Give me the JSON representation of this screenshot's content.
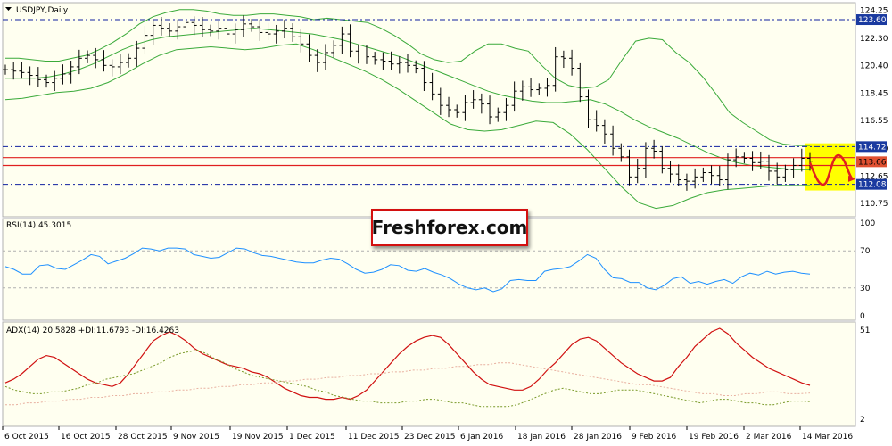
{
  "symbol_title": "USDJPY,Daily",
  "brand": "Freshforex.com",
  "colors": {
    "background": "#fffff0",
    "frame": "#b0b0b0",
    "candle": "#000000",
    "bollinger": "#3aaa3a",
    "level_line": "#1020a0",
    "red_line": "#e02020",
    "rsi_line": "#1e90ff",
    "adx_line": "#d01010",
    "di_plus": "#7a9a2a",
    "di_minus": "#e8b0a0",
    "highlight": "#ffff00",
    "price_label_blue": "#1a3aa0",
    "price_label_red": "#e05030"
  },
  "chart_data": [
    {
      "type": "candlestick",
      "title": "USDJPY,Daily",
      "x": [
        "6 Oct 2015",
        "16 Oct 2015",
        "28 Oct 2015",
        "9 Nov 2015",
        "19 Nov 2015",
        "1 Dec 2015",
        "11 Dec 2015",
        "23 Dec 2015",
        "6 Jan 2016",
        "18 Jan 2016",
        "28 Jan 2016",
        "9 Feb 2016",
        "19 Feb 2016",
        "2 Mar 2016",
        "14 Mar 2016"
      ],
      "y_ticks": [
        "124.25",
        "122.30",
        "120.40",
        "118.45",
        "116.55",
        "114.60",
        "112.65",
        "110.75"
      ],
      "ylim": [
        110.0,
        124.6
      ],
      "levels": [
        {
          "label": "123.60",
          "value": 123.6,
          "style": "dash-dot"
        },
        {
          "label": "114.72",
          "value": 114.72,
          "style": "dash-dot"
        },
        {
          "label": "112.08",
          "value": 112.08,
          "style": "dash-dot"
        }
      ],
      "current_price": {
        "label": "113.66",
        "value": 113.66
      },
      "red_band": [
        113.4,
        113.95
      ],
      "close": [
        120.1,
        120.0,
        119.9,
        119.7,
        119.4,
        119.2,
        119.5,
        119.8,
        120.3,
        120.9,
        121.1,
        120.8,
        120.4,
        120.3,
        120.6,
        120.9,
        121.6,
        122.5,
        123.2,
        123.0,
        122.8,
        123.1,
        123.4,
        123.2,
        122.9,
        122.8,
        123.0,
        122.6,
        122.9,
        123.3,
        123.1,
        122.7,
        122.6,
        122.8,
        123.0,
        122.4,
        121.9,
        121.1,
        120.6,
        121.3,
        121.8,
        122.6,
        121.4,
        121.2,
        121.0,
        120.8,
        120.7,
        120.5,
        120.6,
        120.4,
        120.2,
        119.2,
        118.4,
        117.6,
        117.3,
        117.1,
        117.8,
        118.0,
        117.7,
        116.8,
        117.1,
        117.6,
        118.6,
        118.9,
        118.7,
        118.8,
        119.0,
        121.0,
        120.9,
        120.2,
        118.2,
        116.6,
        116.2,
        115.6,
        114.6,
        114.0,
        112.6,
        113.2,
        114.6,
        114.4,
        113.2,
        112.8,
        112.4,
        112.3,
        112.6,
        112.9,
        112.7,
        112.4,
        113.8,
        114.0,
        113.9,
        113.6,
        113.7,
        113.0,
        112.6,
        113.1,
        113.4,
        113.9,
        113.7
      ],
      "bb_upper": [
        120.9,
        120.9,
        120.8,
        120.7,
        120.7,
        120.9,
        121.1,
        121.5,
        122.0,
        122.6,
        123.3,
        123.8,
        124.1,
        124.3,
        124.3,
        124.2,
        124.0,
        123.9,
        123.9,
        124.0,
        124.0,
        123.9,
        123.8,
        123.6,
        123.7,
        123.6,
        123.5,
        123.4,
        123.0,
        122.5,
        121.9,
        121.2,
        120.8,
        120.6,
        120.7,
        121.4,
        121.9,
        121.9,
        121.6,
        121.4,
        120.4,
        119.5,
        119.0,
        118.8,
        118.9,
        119.4,
        120.8,
        122.1,
        122.3,
        122.2,
        121.3,
        120.6,
        119.6,
        118.4,
        117.1,
        116.4,
        115.8,
        115.2,
        114.9,
        114.8,
        114.8
      ],
      "bb_middle": [
        119.5,
        119.5,
        119.5,
        119.6,
        119.8,
        120.1,
        120.5,
        121.0,
        121.5,
        121.9,
        122.2,
        122.4,
        122.5,
        122.6,
        122.7,
        122.8,
        122.9,
        123.0,
        122.9,
        122.8,
        122.7,
        122.6,
        122.4,
        122.2,
        121.9,
        121.6,
        121.3,
        121.0,
        120.6,
        120.2,
        119.8,
        119.4,
        119.0,
        118.6,
        118.3,
        118.1,
        117.9,
        117.8,
        117.8,
        117.9,
        118.0,
        117.7,
        117.2,
        116.6,
        116.1,
        115.7,
        115.3,
        114.8,
        114.3,
        113.9,
        113.6,
        113.4,
        113.3,
        113.2,
        113.1,
        113.1
      ],
      "bb_lower": [
        118.0,
        118.1,
        118.3,
        118.5,
        118.6,
        118.8,
        119.2,
        119.8,
        120.5,
        121.1,
        121.5,
        121.6,
        121.7,
        121.6,
        121.5,
        121.6,
        121.8,
        121.9,
        121.5,
        121.0,
        120.5,
        120.0,
        119.4,
        118.7,
        117.9,
        117.1,
        116.3,
        115.9,
        115.8,
        115.9,
        116.2,
        116.5,
        116.4,
        115.6,
        114.5,
        113.2,
        111.9,
        110.8,
        110.4,
        110.6,
        111.1,
        111.5,
        111.7,
        111.8,
        111.9,
        112.0,
        112.0,
        112.0
      ]
    },
    {
      "type": "line",
      "title": "RSI(14) 45.3015",
      "y_ticks": [
        "100",
        "70",
        "30",
        "0"
      ],
      "ylim": [
        0,
        100
      ],
      "levels": [
        70,
        30
      ],
      "series": [
        {
          "name": "RSI(14)",
          "values": [
            53,
            50,
            45,
            45,
            54,
            55,
            51,
            50,
            55,
            60,
            66,
            64,
            56,
            59,
            62,
            67,
            73,
            72,
            70,
            73,
            73,
            72,
            66,
            64,
            62,
            63,
            68,
            73,
            72,
            68,
            65,
            64,
            62,
            60,
            58,
            57,
            57,
            60,
            62,
            61,
            56,
            50,
            46,
            47,
            50,
            55,
            54,
            49,
            48,
            51,
            47,
            44,
            40,
            34,
            30,
            28,
            30,
            26,
            29,
            38,
            39,
            38,
            38,
            48,
            50,
            51,
            53,
            59,
            66,
            62,
            50,
            41,
            40,
            36,
            36,
            30,
            28,
            33,
            40,
            42,
            35,
            37,
            34,
            37,
            39,
            35,
            42,
            46,
            44,
            48,
            45,
            47,
            48,
            46,
            45
          ]
        }
      ]
    },
    {
      "type": "line",
      "title": "ADX(14) 20.5828 +DI:11.6793 -DI:16.4263",
      "y_ticks": [
        "51",
        "2"
      ],
      "ylim": [
        2,
        51
      ],
      "series": [
        {
          "name": "ADX(14)",
          "values": [
            22,
            24,
            27,
            31,
            35,
            37,
            36,
            33,
            30,
            27,
            24,
            22,
            21,
            20,
            22,
            27,
            33,
            39,
            45,
            48,
            50,
            48,
            45,
            41,
            38,
            36,
            34,
            32,
            31,
            30,
            28,
            27,
            25,
            22,
            19,
            17,
            15,
            14,
            14,
            13,
            13,
            14,
            13,
            15,
            18,
            23,
            28,
            33,
            38,
            42,
            45,
            47,
            48,
            47,
            43,
            38,
            33,
            28,
            24,
            21,
            20,
            19,
            18,
            18,
            20,
            24,
            29,
            33,
            38,
            43,
            46,
            47,
            45,
            41,
            37,
            33,
            30,
            27,
            25,
            23,
            23,
            25,
            31,
            36,
            42,
            46,
            50,
            52,
            49,
            44,
            40,
            36,
            33,
            30,
            28,
            26,
            24,
            22,
            20.6
          ]
        },
        {
          "name": "+DI",
          "values": [
            20,
            18,
            17,
            16,
            16,
            17,
            17,
            18,
            19,
            21,
            22,
            24,
            25,
            26,
            27,
            29,
            31,
            33,
            36,
            38,
            39,
            40,
            38,
            35,
            33,
            30,
            28,
            26,
            25,
            24,
            23,
            22,
            21,
            20,
            18,
            17,
            15,
            14,
            13,
            12,
            12,
            11,
            11,
            11,
            12,
            12,
            13,
            13,
            12,
            11,
            11,
            10,
            9,
            9,
            9,
            9,
            10,
            12,
            14,
            16,
            18,
            19,
            18,
            17,
            16,
            16,
            17,
            18,
            18,
            18,
            17,
            16,
            15,
            14,
            13,
            12,
            11,
            12,
            13,
            13,
            12,
            11,
            11,
            10,
            10,
            11,
            12,
            12,
            11.7
          ]
        },
        {
          "name": "-DI",
          "values": [
            10,
            10,
            11,
            11,
            12,
            12,
            13,
            13,
            14,
            14,
            15,
            15,
            16,
            16,
            17,
            17,
            18,
            18,
            19,
            19,
            20,
            20,
            21,
            21,
            22,
            22,
            23,
            23,
            24,
            24,
            25,
            25,
            26,
            26,
            27,
            27,
            28,
            28,
            29,
            29,
            30,
            30,
            31,
            31,
            32,
            32,
            33,
            33,
            32,
            31,
            30,
            29,
            28,
            27,
            26,
            25,
            24,
            23,
            22,
            21,
            21,
            20,
            19,
            18,
            17,
            16,
            16,
            15,
            15,
            16,
            16,
            17,
            17,
            16,
            16,
            16.4
          ]
        }
      ]
    }
  ]
}
